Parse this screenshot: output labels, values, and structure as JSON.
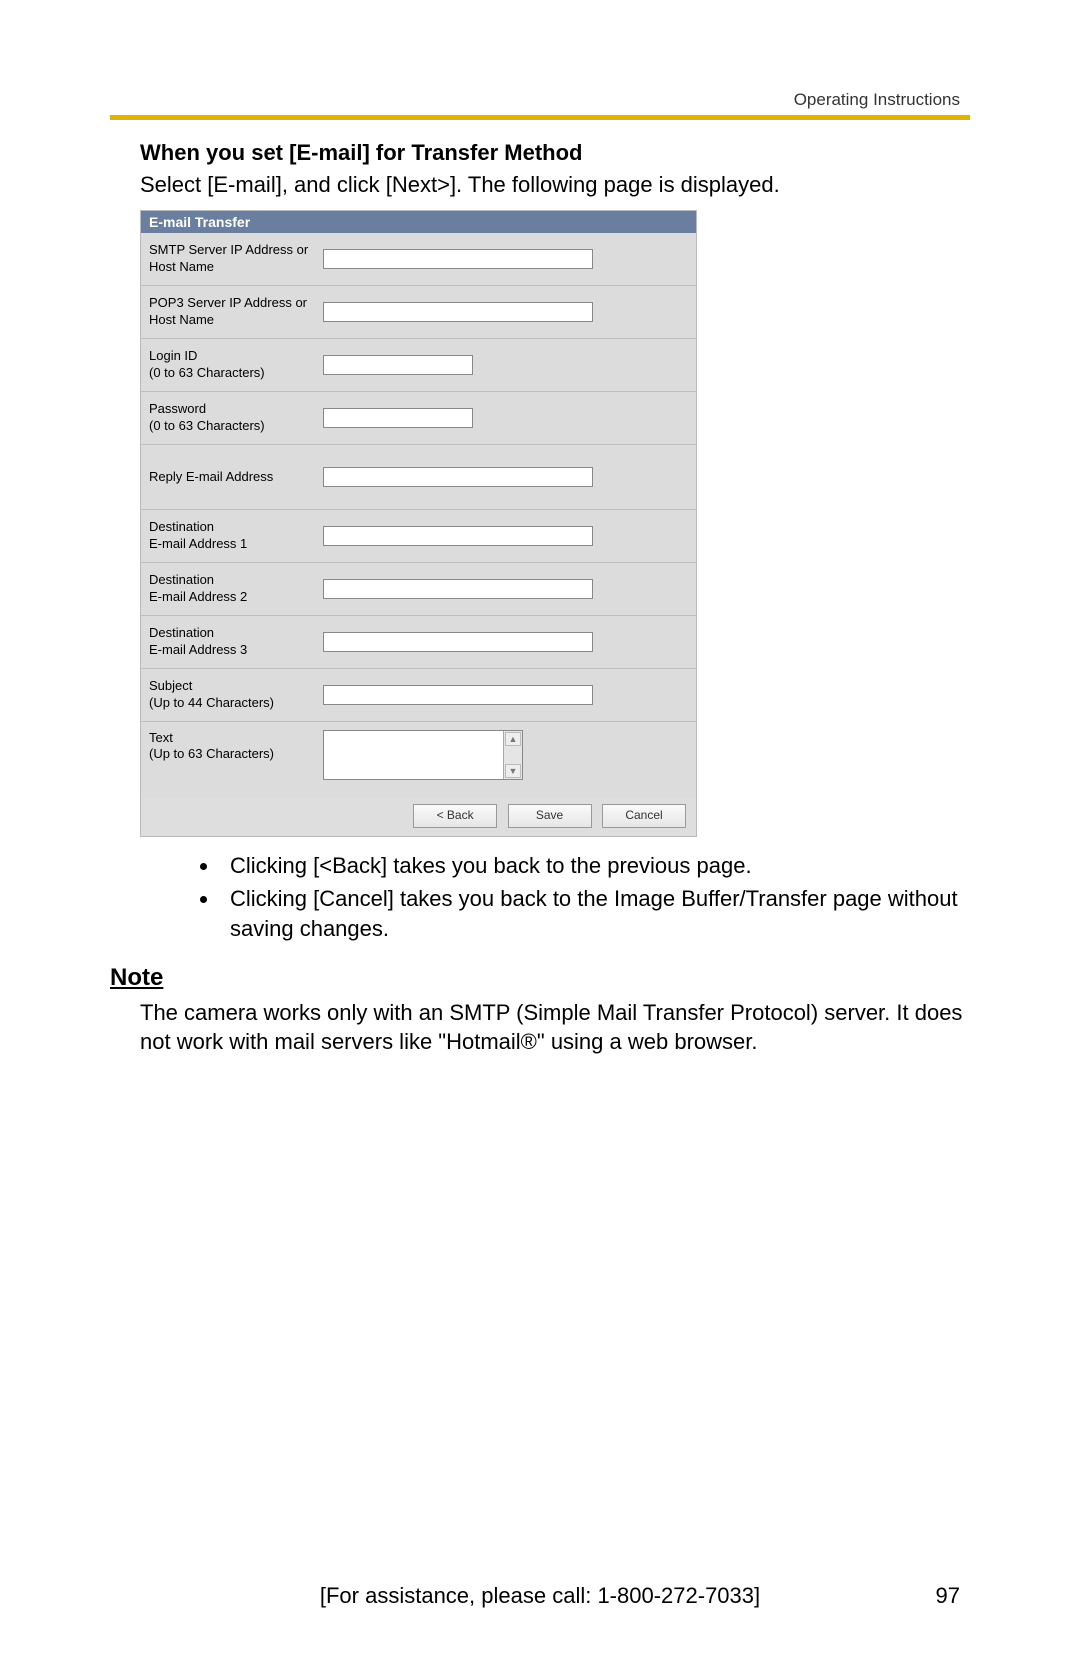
{
  "header": {
    "section": "Operating Instructions"
  },
  "title": "When you set [E-mail] for Transfer Method",
  "intro": "Select [E-mail], and click [Next>]. The following page is displayed.",
  "form": {
    "heading": "E-mail Transfer",
    "rows": [
      {
        "label": "SMTP Server IP Address or Host Name",
        "type": "text",
        "width": "long"
      },
      {
        "label": "POP3 Server IP Address or Host Name",
        "type": "text",
        "width": "long"
      },
      {
        "label": "Login ID\n(0 to 63 Characters)",
        "type": "text",
        "width": "short"
      },
      {
        "label": "Password\n(0 to 63 Characters)",
        "type": "text",
        "width": "short"
      },
      {
        "label": "Reply E-mail Address",
        "type": "text",
        "width": "long"
      },
      {
        "label": "Destination\nE-mail Address 1",
        "type": "text",
        "width": "long"
      },
      {
        "label": "Destination\nE-mail Address 2",
        "type": "text",
        "width": "long"
      },
      {
        "label": "Destination\nE-mail Address 3",
        "type": "text",
        "width": "long"
      },
      {
        "label": "Subject\n(Up to 44 Characters)",
        "type": "text",
        "width": "long"
      },
      {
        "label": "Text\n(Up to 63 Characters)",
        "type": "textarea"
      }
    ],
    "buttons": {
      "back": "< Back",
      "save": "Save",
      "cancel": "Cancel"
    }
  },
  "bullets": [
    "Clicking [<Back] takes you back to the previous page.",
    "Clicking [Cancel] takes you back to the Image Buffer/Transfer page without saving changes."
  ],
  "note": {
    "heading": "Note",
    "text": "The camera works only with an SMTP (Simple Mail Transfer Protocol) server. It does not work with mail servers like \"Hotmail®\" using a web browser."
  },
  "footer": {
    "assist": "[For assistance, please call: 1-800-272-7033]",
    "page": "97"
  }
}
